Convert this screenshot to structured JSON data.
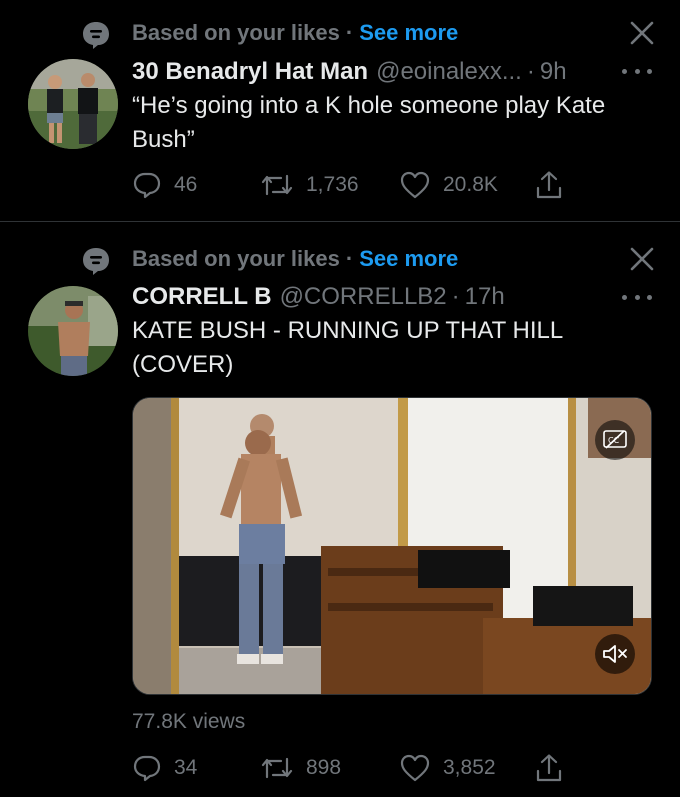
{
  "feed": {
    "tweets": [
      {
        "context_text": "Based on your likes",
        "context_sep": "·",
        "context_link": "See more",
        "author_name": "30 Benadryl Hat Man",
        "author_handle": "@eoinalexx...",
        "time_sep": "·",
        "time": "9h",
        "text": "“He’s going into a K hole someone play Kate Bush”",
        "replies": "46",
        "retweets": "1,736",
        "likes": "20.8K"
      },
      {
        "context_text": "Based on your likes",
        "context_sep": "·",
        "context_link": "See more",
        "author_name": "CORRELL B",
        "author_handle": "@CORRELLB2",
        "time_sep": "·",
        "time": "17h",
        "text": "KATE BUSH - RUNNING UP THAT  HILL (COVER)",
        "views": "77.8K views",
        "replies": "34",
        "retweets": "898",
        "likes": "3,852"
      }
    ]
  },
  "colors": {
    "background": "#000000",
    "text": "#e7e9ea",
    "muted": "#71767b",
    "link": "#1d9bf0",
    "divider": "#2f3336"
  },
  "icons": [
    "topic-bubble-icon",
    "close-icon",
    "more-icon",
    "reply-icon",
    "retweet-icon",
    "like-icon",
    "share-icon",
    "captions-icon",
    "muted-speaker-icon"
  ]
}
